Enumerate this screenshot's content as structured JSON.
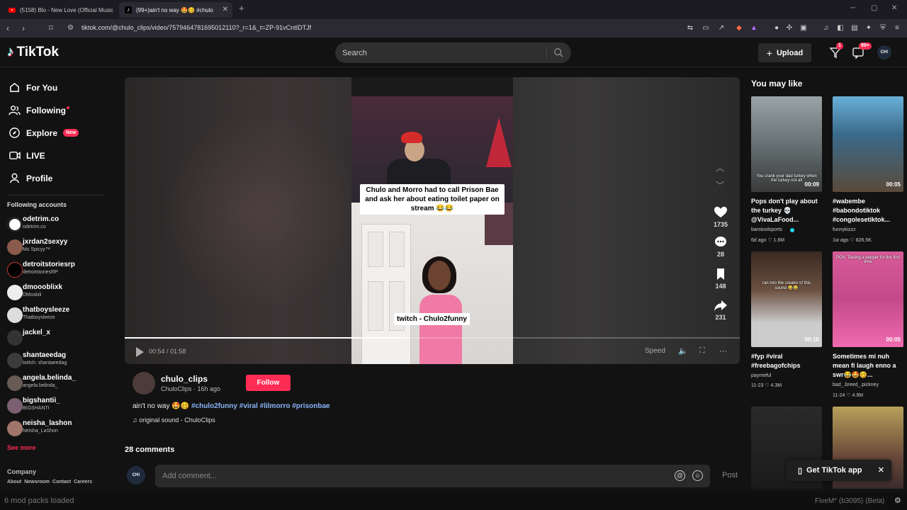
{
  "browser": {
    "tabs": [
      {
        "title": "(5158) Blo - New Love (Official Music",
        "icon": "youtube-icon"
      },
      {
        "title": "(99+)ain't no way 🤩🥴 #chulo",
        "icon": "tiktok-icon"
      }
    ],
    "url": "tiktok.com/@chulo_clips/video/7579464781695012110?_r=1&_t=ZP-91vCntIDTJf"
  },
  "header": {
    "logo_text": "TikTok",
    "search_placeholder": "Search",
    "upload_label": "Upload",
    "inbox_badge": "1",
    "messages_badge": "99+",
    "avatar_text": "CH!"
  },
  "sidebar": {
    "nav": [
      {
        "label": "For You",
        "icon": "home-icon"
      },
      {
        "label": "Following",
        "icon": "users-icon"
      },
      {
        "label": "Explore",
        "icon": "compass-icon",
        "badge": "New"
      },
      {
        "label": "LIVE",
        "icon": "live-icon"
      },
      {
        "label": "Profile",
        "icon": "person-icon"
      }
    ],
    "following_title": "Following accounts",
    "accounts": [
      {
        "username": "odetrim.co",
        "nickname": "odetrim.co"
      },
      {
        "username": "jxrdan2sexyy",
        "nickname": "Ms Spicyy™"
      },
      {
        "username": "detroitstoriesrp",
        "nickname": "detroitstoriesRP"
      },
      {
        "username": "dmoooblixk",
        "nickname": "DMoskiii"
      },
      {
        "username": "thatboysleeze",
        "nickname": "Thatboysleeze"
      },
      {
        "username": "jackel_x",
        "nickname": ""
      },
      {
        "username": "shantaeedag",
        "nickname": "twitch: shantaeedag"
      },
      {
        "username": "angela.belinda_",
        "nickname": "angela.belinda_"
      },
      {
        "username": "bigshantii_",
        "nickname": "BIGSHANTI"
      },
      {
        "username": "neisha_lashon",
        "nickname": "Neisha_LaShon"
      }
    ],
    "see_more": "See more",
    "company_title": "Company",
    "footer_links": [
      "About",
      "Newsroom",
      "Contact",
      "Careers"
    ]
  },
  "video": {
    "caption_top": "Chulo and Morro had to call Prison Bae and ask her about eating toilet paper on stream 😂😂",
    "caption_bottom": "twitch - Chulo2funny",
    "time": "00:54 / 01:58",
    "progress": 0.46,
    "speed_label": "Speed",
    "likes": "1735",
    "comments": "28",
    "saves": "148",
    "shares": "231"
  },
  "post": {
    "author": "chulo_clips",
    "author_sub": "ChuloClips · 16h ago",
    "follow_label": "Follow",
    "description_text": "ain't no way 🤩🥴",
    "hashtags": "#chulo2funny #viral #lilmorro #prisonbae",
    "sound": "♫ original sound - ChuloClips",
    "comments_title": "28 comments",
    "comment_placeholder": "Add comment...",
    "post_label": "Post"
  },
  "recommend": {
    "title": "You may like",
    "cards": [
      {
        "title": "Pops don't play about the turkey 💀 @VivaLaFood...",
        "author": "barstoolsports",
        "meta": "6d ago  ♡ 1.6M",
        "duration": "00:09",
        "overlay": "You crank your dad turkey when the turkey not all"
      },
      {
        "title": "#wabembe #babondotiktok #congolesetiktok...",
        "author": "funnykizzz",
        "meta": "1w ago  ♡ 826.5K",
        "duration": "00:05",
        "overlay": ""
      },
      {
        "title": "#fyp #viral #freebagofchips",
        "author": "paymeful",
        "meta": "11-23  ♡ 4.3M",
        "duration": "00:10",
        "overlay": "ran into the creator of this sound 😂😂"
      },
      {
        "title": "Sometimes mi nuh mean fi laugh enno a swr😂🤩🥴...",
        "author": "bad_.breed_.pickney",
        "meta": "11-24  ♡ 4.9M",
        "duration": "00:05",
        "overlay": "POV: Tasting a pepper for the first time"
      },
      {
        "title": "",
        "author": "",
        "meta": "",
        "duration": "",
        "overlay": ""
      },
      {
        "title": "",
        "author": "",
        "meta": "",
        "duration": "",
        "overlay": ""
      }
    ]
  },
  "getapp": {
    "label": "Get TikTok app"
  },
  "status": {
    "left": "6 mod packs loaded",
    "right": "FiveM* (b3095) (Beta)"
  },
  "colors": {
    "accent": "#fe2c55",
    "background": "#121212",
    "hashtag": "#8ab4f8"
  }
}
